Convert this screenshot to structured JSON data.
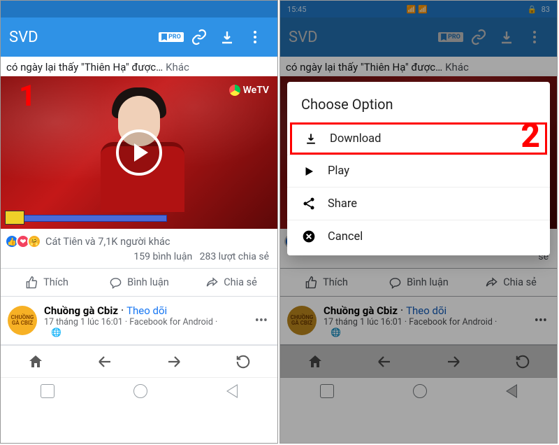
{
  "statusbar": {
    "time": "15:45",
    "battery": "83"
  },
  "appbar": {
    "title": "SVD",
    "pro_label": "PRO"
  },
  "post": {
    "caption": "có ngày lại thấy \"Thiên Hạ\" được…",
    "caption_more": "Khác",
    "watermark": "WeTV",
    "reactions_text": "Cát Tiên và 7,1K người khác",
    "comments": "159 bình luận",
    "shares": "283 lượt chia sẻ",
    "actions": {
      "like": "Thích",
      "comment": "Bình luận",
      "share": "Chia sẻ"
    }
  },
  "post2": {
    "name": "Chuồng gà Cbiz",
    "follow": "Theo dõi",
    "sub": "17 tháng 1 lúc 16:01 · Facebook for Android",
    "avatar_text": "CHUỒNG GÀ CBIZ"
  },
  "dialog": {
    "title": "Choose Option",
    "download": "Download",
    "play": "Play",
    "share": "Share",
    "cancel": "Cancel"
  },
  "step": {
    "one": "1",
    "two": "2"
  }
}
